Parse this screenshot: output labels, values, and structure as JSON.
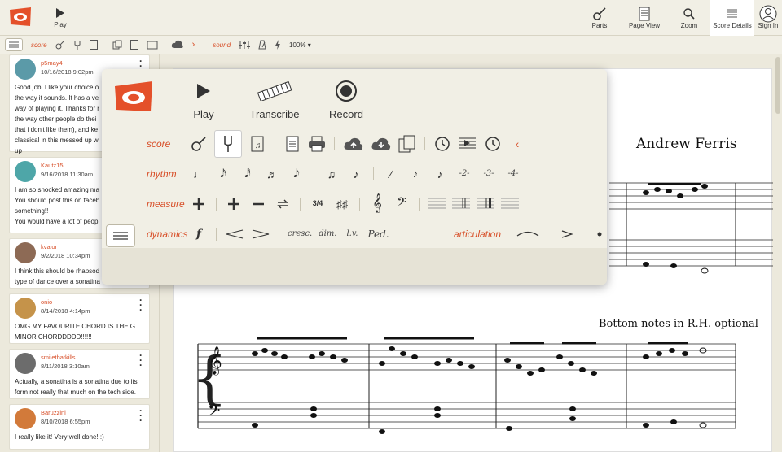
{
  "topbar": {
    "play_label": "Play",
    "nav": [
      {
        "label": "Parts",
        "icon": "guitar-icon"
      },
      {
        "label": "Page View",
        "icon": "page-icon"
      },
      {
        "label": "Zoom",
        "icon": "magnifier-icon"
      },
      {
        "label": "Score Details",
        "icon": "list-icon",
        "active": true
      },
      {
        "label": "Sign In",
        "icon": "user-icon"
      }
    ]
  },
  "subbar": {
    "score_label": "score",
    "sound_label": "sound",
    "zoom_label": "100%",
    "zoom_caret": "▾"
  },
  "comments": [
    {
      "name": "p5may4",
      "date": "10/16/2018 9:02pm",
      "avatar_color": "#5b9aa8",
      "body": "Good job! I like your choice o\nthe way it sounds. It has a ve\nway of playing it. Thanks for r\nthe way other people do thei\nthat i don't like them), and ke\nclassical in this messed up w\nup"
    },
    {
      "name": "Kautz15",
      "date": "9/16/2018 11:30am",
      "avatar_color": "#4ea6a8",
      "body": "I am so shocked amazing ma\nYou should post this on faceb\nsomething!!\nYou would have a lot of peop"
    },
    {
      "name": "kvalor",
      "date": "9/2/2018 10:34pm",
      "avatar_color": "#8d6a55",
      "body": "I think this should be rhapsod\ntype of dance over a sonatina"
    },
    {
      "name": "onio",
      "date": "8/14/2018 4:14pm",
      "avatar_color": "#c5934a",
      "body": "OMG.MY FAVOURITE CHORD IS THE G\nMINOR CHORDDDDD!!!!!!"
    },
    {
      "name": "smilethatkills",
      "date": "8/11/2018 3:10am",
      "avatar_color": "#6c6c6c",
      "body": "Actually, a sonatina is a sonatina due to its\nform not really that much on the tech side."
    },
    {
      "name": "Baruzzini",
      "date": "8/10/2018 6:55pm",
      "avatar_color": "#d27a3a",
      "body": "I really like it! Very well done! :)"
    }
  ],
  "popup": {
    "play_label": "Play",
    "transcribe_label": "Transcribe",
    "record_label": "Record",
    "rows": {
      "score": "score",
      "rhythm": "rhythm",
      "measure": "measure",
      "dynamics": "dynamics",
      "articulation": "articulation"
    },
    "tuplets": [
      "-2-",
      "-3-",
      "-4-"
    ],
    "time_sig": "3/4",
    "dyn_f": "f",
    "cresc": "cresc.",
    "dim": "dim.",
    "lv": "l.v.",
    "ped": "Ped."
  },
  "score": {
    "composer": "Andrew Ferris",
    "annotation": "Bottom notes in R.H. optional"
  },
  "colors": {
    "accent": "#d8502a",
    "background": "#ece9dc",
    "panel": "#f1efe5"
  }
}
